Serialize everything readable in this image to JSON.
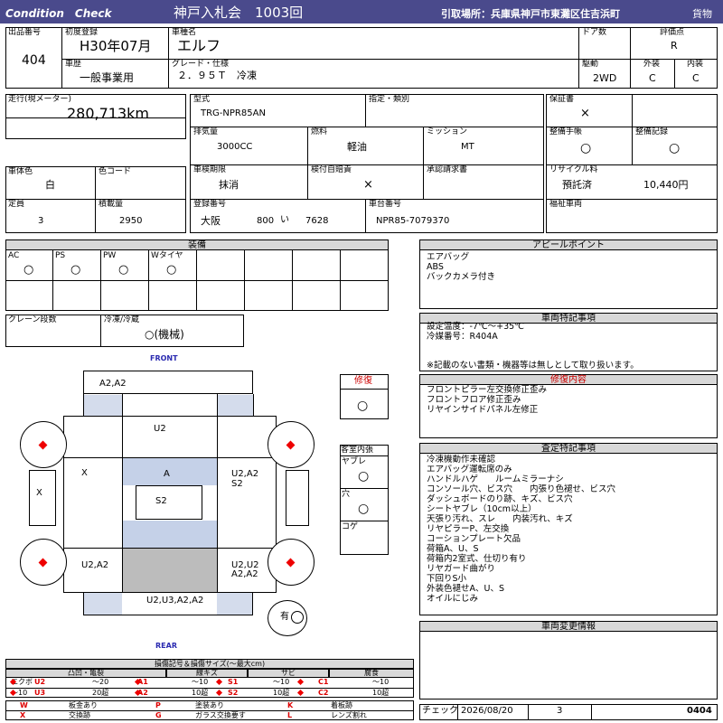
{
  "header": {
    "left": "Condition　Check",
    "title": "神戸入札会　1003回",
    "location": "引取場所：兵庫県神戸市東灘区住吉浜町",
    "type": "貨物"
  },
  "top": {
    "lot_label": "出品番号",
    "lot": "404",
    "first_reg_label": "初度登録",
    "first_reg": "H30年07月",
    "car_name_label": "車種名",
    "car_name": "エルフ",
    "door_label": "ドア数",
    "door": "",
    "score_label": "評価点",
    "score": "R",
    "history_label": "車歴",
    "history": "一般事業用",
    "grade_label": "グレード・仕様",
    "grade": "２．９５Ｔ　冷凍",
    "drive_label": "駆動",
    "drive": "2WD",
    "exterior_label": "外装",
    "exterior": "C",
    "interior_label": "内装",
    "interior": "C"
  },
  "mid": {
    "mileage_label": "走行(現メーター)",
    "mileage": "280,713km",
    "model_label": "型式",
    "model": "TRG-NPR85AN",
    "designation_label": "指定・類別",
    "warranty_label": "保証書",
    "warranty": "×",
    "displacement_label": "排気量",
    "displacement": "3000CC",
    "fuel_label": "燃料",
    "fuel": "軽油",
    "mission_label": "ミッション",
    "mission": "MT",
    "manual_label": "整備手帳",
    "manual": "○",
    "record_label": "整備記録",
    "record": "○",
    "color_label": "車体色",
    "color": "白",
    "color_code_label": "色コード",
    "inspection_label": "車検期限",
    "inspection": "抹消",
    "insurance_label": "検付自賠責",
    "insurance": "×",
    "approval_label": "承認請求書",
    "recycle_label": "リサイクル料",
    "recycle_status": "預託済",
    "recycle_amount": "10,440円",
    "capacity_label": "定員",
    "capacity": "3",
    "load_label": "積載量",
    "load": "2950",
    "reg_label": "登録番号",
    "reg_area": "大阪",
    "reg_num": "800",
    "reg_kana": "い",
    "reg_serial": "7628",
    "chassis_label": "車台番号",
    "chassis": "NPR85-7079370",
    "welfare_label": "福祉車両"
  },
  "equip": {
    "title": "装備",
    "ac_label": "AC",
    "ac": "○",
    "ps_label": "PS",
    "ps": "○",
    "pw_label": "PW",
    "pw": "○",
    "wtire_label": "Wタイヤ",
    "wtire": "○",
    "crane_label": "クレーン段数",
    "fridge_label": "冷凍/冷蔵",
    "fridge": "○(機械)"
  },
  "diagram": {
    "front": "FRONT",
    "rear": "REAR",
    "roof_front": "A2,A2",
    "front_upper": "U2",
    "left_side": "X",
    "left_panel": "X",
    "center": "A",
    "cargo": "S2",
    "right_upper": "U2,A2",
    "right_lower": "S2",
    "left_rear": "U2,A2",
    "right_rear1": "U2,U2",
    "right_rear2": "A2,A2",
    "rear_bottom": "U2,U3,A2,A2",
    "yu": "有"
  },
  "repair": {
    "label": "修復",
    "value": "○"
  },
  "cabin": {
    "label": "客室内張",
    "yabure": "ヤブレ",
    "yabure_v": "○",
    "ana": "穴",
    "ana_v": "○",
    "koge": "コゲ"
  },
  "appeal": {
    "title": "アピールポイント",
    "lines": [
      "エアバッグ",
      "ABS",
      "バックカメラ付き"
    ]
  },
  "special": {
    "title": "車両特記事項",
    "lines": [
      "設定温度：-7℃～+35℃",
      "冷媒番号：R404A"
    ],
    "note": "※記載のない書類・機器等は無しとして取り扱います。"
  },
  "repair_detail": {
    "title": "修復内容",
    "lines": [
      "フロントピラー左交換修正歪み",
      "フロントフロア修正歪み",
      "リヤインサイドパネル左修正"
    ]
  },
  "inspect": {
    "title": "査定特記事項",
    "lines": [
      "冷凍機動作未確認",
      "エアバッグ運転席のみ",
      "ハンドルハゲ　　ルームミラーナシ",
      "コンソール穴、ビス穴　　内張り色褪せ、ビス穴",
      "ダッシュボードのり跡、キズ、ビス穴",
      "シートヤブレ（10cm以上）",
      "天張り汚れ、スレ　　内装汚れ、キズ",
      "リヤピラーP、左交換",
      "コーションプレート欠品",
      "荷箱A、U、S",
      "荷箱内2室式、仕切り有り",
      "リヤガード曲がり",
      "下回りS小",
      "外装色褪せA、U、S",
      "オイルにじみ"
    ]
  },
  "change": {
    "title": "車両変更情報"
  },
  "legend": {
    "title": "損傷記号＆損傷サイズ(～最大cm)",
    "g1": "凸凹・亀裂",
    "g2": "線キズ",
    "g3": "サビ",
    "g4": "腐食",
    "r1": [
      "エクボ",
      "U2",
      "～20",
      "A1",
      "～10",
      "S1",
      "～10",
      "C1",
      "～10"
    ],
    "r2": [
      "～10",
      "U3",
      "20超",
      "A2",
      "10超",
      "S2",
      "10超",
      "C2",
      "10超"
    ],
    "r3": [
      "W",
      "板金あり",
      "P",
      "塗装あり",
      "K",
      "着板跡"
    ],
    "r4": [
      "X",
      "交換跡",
      "G",
      "ガラス交換要す",
      "L",
      "レンズ割れ"
    ]
  },
  "check": {
    "label": "チェック",
    "date": "2026/08/20",
    "count": "3",
    "number": "0404"
  }
}
